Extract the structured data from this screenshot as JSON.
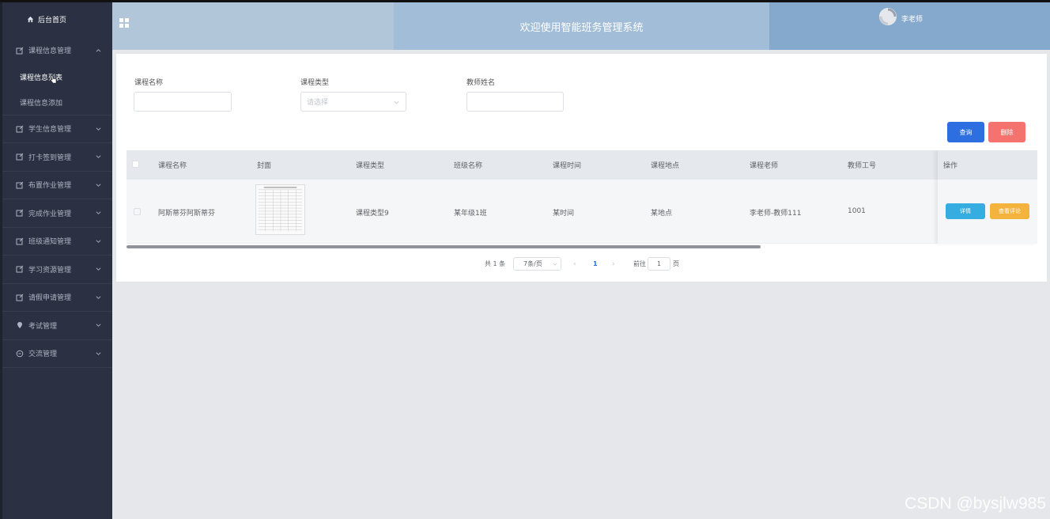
{
  "sidebar": {
    "home": "后台首页",
    "menus": [
      {
        "label": "课程信息管理",
        "icon": "edit-icon",
        "expanded": true,
        "children": [
          {
            "label": "课程信息列表",
            "active": true
          },
          {
            "label": "课程信息添加",
            "active": false
          }
        ]
      },
      {
        "label": "学生信息管理",
        "icon": "edit-icon"
      },
      {
        "label": "打卡签到管理",
        "icon": "edit-icon"
      },
      {
        "label": "布置作业管理",
        "icon": "edit-icon"
      },
      {
        "label": "完成作业管理",
        "icon": "edit-icon"
      },
      {
        "label": "班级通知管理",
        "icon": "edit-icon"
      },
      {
        "label": "学习资源管理",
        "icon": "edit-icon"
      },
      {
        "label": "请假申请管理",
        "icon": "edit-icon"
      },
      {
        "label": "考试管理",
        "icon": "location-icon"
      },
      {
        "label": "交流管理",
        "icon": "chat-icon"
      }
    ]
  },
  "header": {
    "title": "欢迎使用智能班务管理系统",
    "username": "李老师"
  },
  "filters": {
    "course_name_label": "课程名称",
    "course_type_label": "课程类型",
    "course_type_placeholder": "请选择",
    "teacher_name_label": "教师姓名"
  },
  "actions": {
    "query": "查询",
    "delete": "删除"
  },
  "table": {
    "columns": [
      "课程名称",
      "封面",
      "课程类型",
      "班级名称",
      "课程时间",
      "课程地点",
      "课程老师",
      "教师工号",
      "操作"
    ],
    "rows": [
      {
        "course_name": "阿斯蒂芬阿斯蒂芬",
        "course_type": "课程类型9",
        "class_name": "某年级1班",
        "time": "某时间",
        "place": "某地点",
        "teacher": "李老师-教师111",
        "teacher_id": "1001",
        "detail_btn": "详情",
        "comment_btn": "查看评论"
      }
    ]
  },
  "pagination": {
    "total": "共 1 条",
    "page_size": "7条/页",
    "current_page": "1",
    "goto_label": "前往",
    "goto_value": "1",
    "page_unit": "页"
  },
  "watermark": "CSDN @bysjlw985",
  "colors": {
    "sidebar_bg": "#2b3142",
    "primary": "#2d6fe0",
    "danger": "#f5736f",
    "info": "#35ade0",
    "warning": "#f4b33d"
  }
}
